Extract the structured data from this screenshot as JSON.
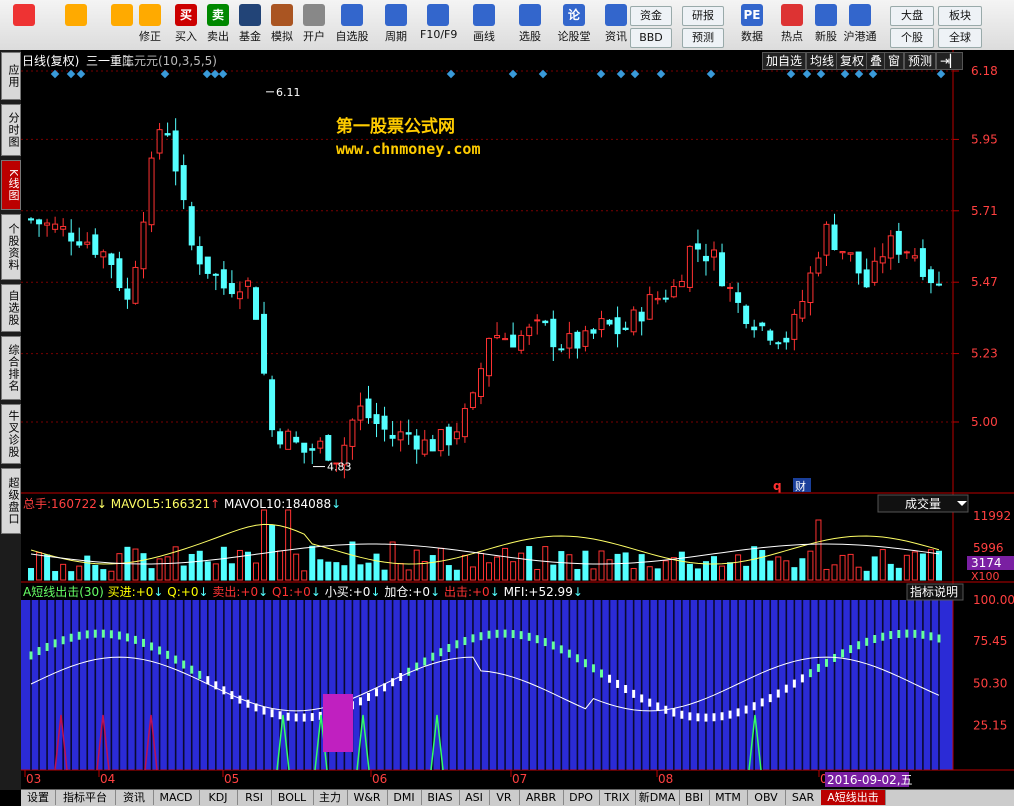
{
  "toolbar": {
    "buttons": [
      {
        "label": "",
        "icon": "grid-icon"
      },
      {
        "label": "",
        "icon": "back-arrow-icon"
      },
      {
        "label": "",
        "icon": "up-arrow-icon"
      },
      {
        "label": "修正",
        "icon": "refresh-icon"
      },
      {
        "label": "买入",
        "icon": "buy-icon",
        "glyph": "买"
      },
      {
        "label": "卖出",
        "icon": "sell-icon",
        "glyph": "卖"
      },
      {
        "label": "基金",
        "icon": "fund-icon"
      },
      {
        "label": "模拟",
        "icon": "hammer-icon"
      },
      {
        "label": "开户",
        "icon": "lock-icon"
      },
      {
        "label": "自选股",
        "icon": "star-icon"
      },
      {
        "label": "周期",
        "icon": "clock-icon"
      },
      {
        "label": "F10/F9",
        "icon": "f10-icon"
      },
      {
        "label": "画线",
        "icon": "pencil-icon"
      },
      {
        "label": "选股",
        "icon": "select-icon"
      },
      {
        "label": "论股堂",
        "icon": "forum-icon",
        "glyph": "论"
      },
      {
        "label": "资讯",
        "icon": "news-icon"
      },
      {
        "label": "数据",
        "icon": "pe-icon",
        "glyph": "PE"
      },
      {
        "label": "热点",
        "icon": "hot-icon"
      },
      {
        "label": "新股",
        "icon": "newstock-icon"
      },
      {
        "label": "沪港通",
        "icon": "hk-icon"
      }
    ],
    "small_buttons": {
      "funds": "资金",
      "bbd": "BBD",
      "research": "研报",
      "forecast": "预测",
      "market": "大盘",
      "sector": "板块",
      "stock": "个股",
      "global": "全球"
    }
  },
  "sidebar": {
    "items": [
      {
        "label": "应用"
      },
      {
        "label": "分时图"
      },
      {
        "label": "K线图"
      },
      {
        "label": "个股资料"
      },
      {
        "label": "自选股"
      },
      {
        "label": "综合排名"
      },
      {
        "label": "牛叉诊股"
      },
      {
        "label": "超级盘口"
      }
    ]
  },
  "header": {
    "period": "日线(复权)",
    "stock_name": "三一重工",
    "indicator": "陈元元(10,3,5,5)",
    "buttons": [
      "加自选",
      "均线",
      "复权",
      "叠",
      "窗",
      "预测",
      "⇥▏"
    ]
  },
  "watermark": {
    "line1": "第一股票公式网",
    "line2": "www.chnmoney.com"
  },
  "price_axis": [
    "6.18",
    "5.95",
    "5.71",
    "5.47",
    "5.23",
    "5.00"
  ],
  "price_annotations": {
    "high": "6.11",
    "low": "4.83"
  },
  "markers": {
    "q": "q",
    "cai": "财"
  },
  "volume": {
    "label_total": "总手:",
    "total": "160722",
    "mavol5_label": "MAVOL5:",
    "mavol5": "166321",
    "mavol10_label": "MAVOL10:",
    "mavol10": "184088",
    "axis": [
      "11992",
      "5996"
    ],
    "current": "3174",
    "unit": "X100",
    "dropdown": "成交量"
  },
  "indicator_panel": {
    "name": "A短线出击(30)",
    "items": [
      {
        "label": "买进:",
        "value": "+0",
        "color": "#ffff00"
      },
      {
        "label": "Q:",
        "value": "+0",
        "color": "#ffff00"
      },
      {
        "label": "卖出:",
        "value": "+0",
        "color": "#ff3333"
      },
      {
        "label": "Q1:",
        "value": "+0",
        "color": "#ff3333"
      },
      {
        "label": "小买:",
        "value": "+0",
        "color": "#ffffff"
      },
      {
        "label": "加仓:",
        "value": "+0",
        "color": "#ffffff"
      },
      {
        "label": "出击:",
        "value": "+0",
        "color": "#ff3333"
      },
      {
        "label": "MFI:",
        "value": "+52.99",
        "color": "#ffffff"
      }
    ],
    "help_button": "指标说明",
    "axis": [
      "100.00",
      "75.45",
      "50.30",
      "25.15"
    ]
  },
  "date_axis": [
    "03",
    "04",
    "05",
    "06",
    "07",
    "08",
    "0"
  ],
  "date_cursor": "2016-09-02,五",
  "bottom_tabs": [
    "设置",
    "指标平台",
    "资讯",
    "MACD",
    "KDJ",
    "RSI",
    "BOLL",
    "主力",
    "W&R",
    "DMI",
    "BIAS",
    "ASI",
    "VR",
    "ARBR",
    "DPO",
    "TRIX",
    "新DMA",
    "BBI",
    "MTM",
    "OBV",
    "SAR",
    "A短线出击"
  ],
  "chart_data": {
    "type": "candlestick",
    "title": "三一重工 日线(复权)",
    "ylim": [
      4.83,
      6.18
    ],
    "y_ticks": [
      6.18,
      5.95,
      5.71,
      5.47,
      5.23,
      5.0
    ],
    "x_labels": [
      "03",
      "04",
      "05",
      "06",
      "07",
      "08"
    ],
    "high_label": 6.11,
    "low_label": 4.83,
    "colors": {
      "up": "#ff3232",
      "down": "#54ffff",
      "ma": "#ffffff"
    }
  }
}
